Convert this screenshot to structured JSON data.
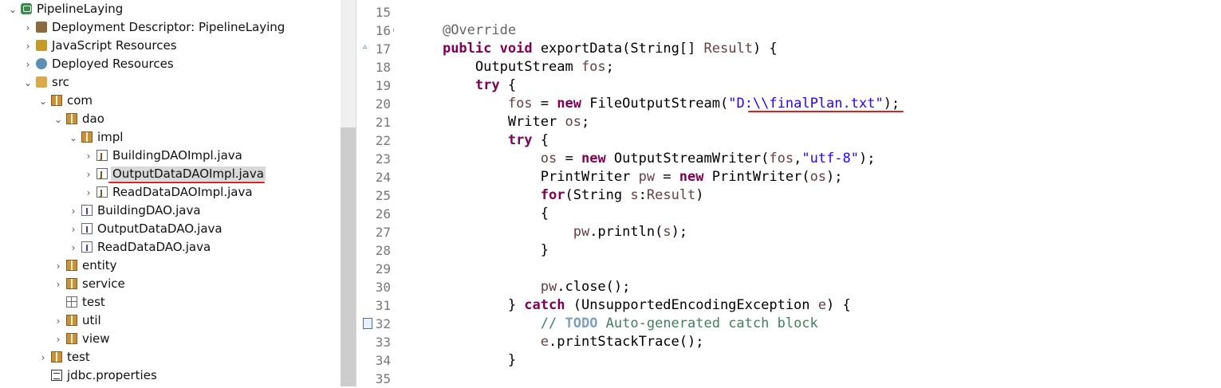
{
  "explorer": {
    "items": [
      {
        "label": "PipelineLaying",
        "expanded": true,
        "icon": "project-icon"
      },
      {
        "label": "Deployment Descriptor: PipelineLaying",
        "expanded": false,
        "icon": "deployment-descriptor-icon"
      },
      {
        "label": "JavaScript Resources",
        "expanded": false,
        "icon": "javascript-resources-icon"
      },
      {
        "label": "Deployed Resources",
        "expanded": false,
        "icon": "deployed-resources-icon"
      },
      {
        "label": "src",
        "expanded": true,
        "icon": "source-folder-icon"
      },
      {
        "label": "com",
        "expanded": true,
        "icon": "package-icon"
      },
      {
        "label": "dao",
        "expanded": true,
        "icon": "package-icon"
      },
      {
        "label": "impl",
        "expanded": true,
        "icon": "package-icon"
      },
      {
        "label": "BuildingDAOImpl.java",
        "expanded": false,
        "icon": "java-class-file-icon"
      },
      {
        "label": "OutputDataDAOImpl.java",
        "expanded": false,
        "icon": "java-class-file-icon",
        "selected": true
      },
      {
        "label": "ReadDataDAOImpl.java",
        "expanded": false,
        "icon": "java-class-file-icon"
      },
      {
        "label": "BuildingDAO.java",
        "expanded": false,
        "icon": "java-interface-file-icon"
      },
      {
        "label": "OutputDataDAO.java",
        "expanded": false,
        "icon": "java-interface-file-icon"
      },
      {
        "label": "ReadDataDAO.java",
        "expanded": false,
        "icon": "java-interface-file-icon"
      },
      {
        "label": "entity",
        "expanded": false,
        "icon": "package-icon"
      },
      {
        "label": "service",
        "expanded": false,
        "icon": "package-icon"
      },
      {
        "label": "test",
        "expanded": false,
        "icon": "empty-package-icon"
      },
      {
        "label": "util",
        "expanded": false,
        "icon": "package-icon"
      },
      {
        "label": "view",
        "expanded": false,
        "icon": "package-icon"
      },
      {
        "label": "test",
        "expanded": false,
        "icon": "package-icon"
      },
      {
        "label": "jdbc.properties",
        "expanded": false,
        "icon": "properties-file-icon"
      }
    ]
  },
  "editor": {
    "line_numbers": [
      "15",
      "16",
      "17",
      "18",
      "19",
      "20",
      "21",
      "22",
      "23",
      "24",
      "25",
      "26",
      "27",
      "28",
      "29",
      "30",
      "31",
      "32",
      "33",
      "34",
      "35"
    ],
    "lines": [
      [],
      [
        {
          "t": "    "
        },
        {
          "t": "@Override",
          "c": "ann"
        }
      ],
      [
        {
          "t": "    "
        },
        {
          "t": "public",
          "c": "kw"
        },
        {
          "t": " "
        },
        {
          "t": "void",
          "c": "kw"
        },
        {
          "t": " exportData(String[] "
        },
        {
          "t": "Result",
          "c": "var"
        },
        {
          "t": ") {"
        }
      ],
      [
        {
          "t": "        OutputStream "
        },
        {
          "t": "fos",
          "c": "var"
        },
        {
          "t": ";"
        }
      ],
      [
        {
          "t": "        "
        },
        {
          "t": "try",
          "c": "kw"
        },
        {
          "t": " {"
        }
      ],
      [
        {
          "t": "            "
        },
        {
          "t": "fos",
          "c": "var"
        },
        {
          "t": " = "
        },
        {
          "t": "new",
          "c": "kw"
        },
        {
          "t": " FileOutputStream("
        },
        {
          "t": "\"D:\\\\finalPlan.txt\"",
          "c": "str"
        },
        {
          "t": ");"
        }
      ],
      [
        {
          "t": "            Writer "
        },
        {
          "t": "os",
          "c": "var"
        },
        {
          "t": ";"
        }
      ],
      [
        {
          "t": "            "
        },
        {
          "t": "try",
          "c": "kw"
        },
        {
          "t": " {"
        }
      ],
      [
        {
          "t": "                "
        },
        {
          "t": "os",
          "c": "var"
        },
        {
          "t": " = "
        },
        {
          "t": "new",
          "c": "kw"
        },
        {
          "t": " OutputStreamWriter("
        },
        {
          "t": "fos",
          "c": "var"
        },
        {
          "t": ","
        },
        {
          "t": "\"utf-8\"",
          "c": "str"
        },
        {
          "t": ");"
        }
      ],
      [
        {
          "t": "                PrintWriter "
        },
        {
          "t": "pw",
          "c": "var"
        },
        {
          "t": " = "
        },
        {
          "t": "new",
          "c": "kw"
        },
        {
          "t": " PrintWriter("
        },
        {
          "t": "os",
          "c": "var"
        },
        {
          "t": ");"
        }
      ],
      [
        {
          "t": "                "
        },
        {
          "t": "for",
          "c": "kw"
        },
        {
          "t": "(String "
        },
        {
          "t": "s",
          "c": "var"
        },
        {
          "t": ":"
        },
        {
          "t": "Result",
          "c": "var"
        },
        {
          "t": ")"
        }
      ],
      [
        {
          "t": "                {"
        }
      ],
      [
        {
          "t": "                    "
        },
        {
          "t": "pw",
          "c": "var"
        },
        {
          "t": ".println("
        },
        {
          "t": "s",
          "c": "var"
        },
        {
          "t": ");"
        }
      ],
      [
        {
          "t": "                }"
        }
      ],
      [],
      [
        {
          "t": "                "
        },
        {
          "t": "pw",
          "c": "var"
        },
        {
          "t": ".close();"
        }
      ],
      [
        {
          "t": "            } "
        },
        {
          "t": "catch",
          "c": "kw"
        },
        {
          "t": " (UnsupportedEncodingException "
        },
        {
          "t": "e",
          "c": "var"
        },
        {
          "t": ") {"
        }
      ],
      [
        {
          "t": "                "
        },
        {
          "t": "// ",
          "c": "cmt"
        },
        {
          "t": "TODO",
          "c": "todo"
        },
        {
          "t": " Auto-generated catch block",
          "c": "cmt"
        }
      ],
      [
        {
          "t": "                "
        },
        {
          "t": "e",
          "c": "var"
        },
        {
          "t": ".printStackTrace();"
        }
      ],
      [
        {
          "t": "            }"
        }
      ],
      []
    ]
  },
  "colors": {
    "keyword": "#7f0055",
    "string": "#2a00ff",
    "comment": "#3f7f5f",
    "annotation": "#646464",
    "variable": "#6a3e3e",
    "underline": "#e0201c",
    "selection": "#d9d9d9"
  }
}
